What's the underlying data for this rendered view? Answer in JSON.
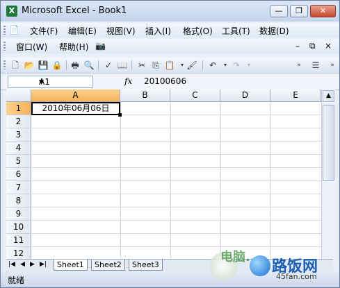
{
  "window": {
    "title": "Microsoft Excel - Book1",
    "app_icon": "X",
    "controls": {
      "minimize": "—",
      "restore": "❐",
      "close": "✕"
    }
  },
  "menu": {
    "row1": [
      "文件(F)",
      "编辑(E)",
      "视图(V)",
      "插入(I)",
      "格式(O)",
      "工具(T)",
      "数据(D)"
    ],
    "row2": [
      "窗口(W)",
      "帮助(H)"
    ],
    "doc_controls": {
      "minimize": "–",
      "restore": "⧉",
      "close": "×"
    }
  },
  "toolbar": {
    "icons": [
      "new-icon",
      "open-icon",
      "save-icon",
      "permission-icon",
      "print-icon",
      "print-preview-icon",
      "spelling-icon",
      "research-icon",
      "cut-icon",
      "copy-icon",
      "paste-icon",
      "format-painter-icon",
      "undo-icon",
      "redo-icon"
    ],
    "glyphs": [
      "🗋",
      "📂",
      "💾",
      "🔒",
      "🖶",
      "🔍",
      "✓",
      "📖",
      "✂",
      "⎘",
      "📋",
      "🖌",
      "↶",
      "↷"
    ]
  },
  "formula_bar": {
    "name_box": "A1",
    "fx_label": "fx",
    "value": "20100606"
  },
  "sheet": {
    "columns": [
      "A",
      "B",
      "C",
      "D",
      "E"
    ],
    "rows": [
      "1",
      "2",
      "3",
      "4",
      "5",
      "6",
      "7",
      "8",
      "9",
      "10",
      "11",
      "12"
    ],
    "cell_A1": "2010年06月06日",
    "active_cell": "A1"
  },
  "sheet_tabs": {
    "nav": [
      "|◀",
      "◀",
      "▶",
      "▶|"
    ],
    "tabs": [
      "Sheet1",
      "Sheet2",
      "Sheet3"
    ],
    "active": "Sheet1"
  },
  "status": {
    "text": "就绪"
  },
  "watermark": {
    "text": "路饭网",
    "url": "45fan.com",
    "partial": "电脑..."
  },
  "colors": {
    "active_header": "#f6b25c",
    "title_bar": "#c3d4ec",
    "close_button": "#c8472b"
  }
}
